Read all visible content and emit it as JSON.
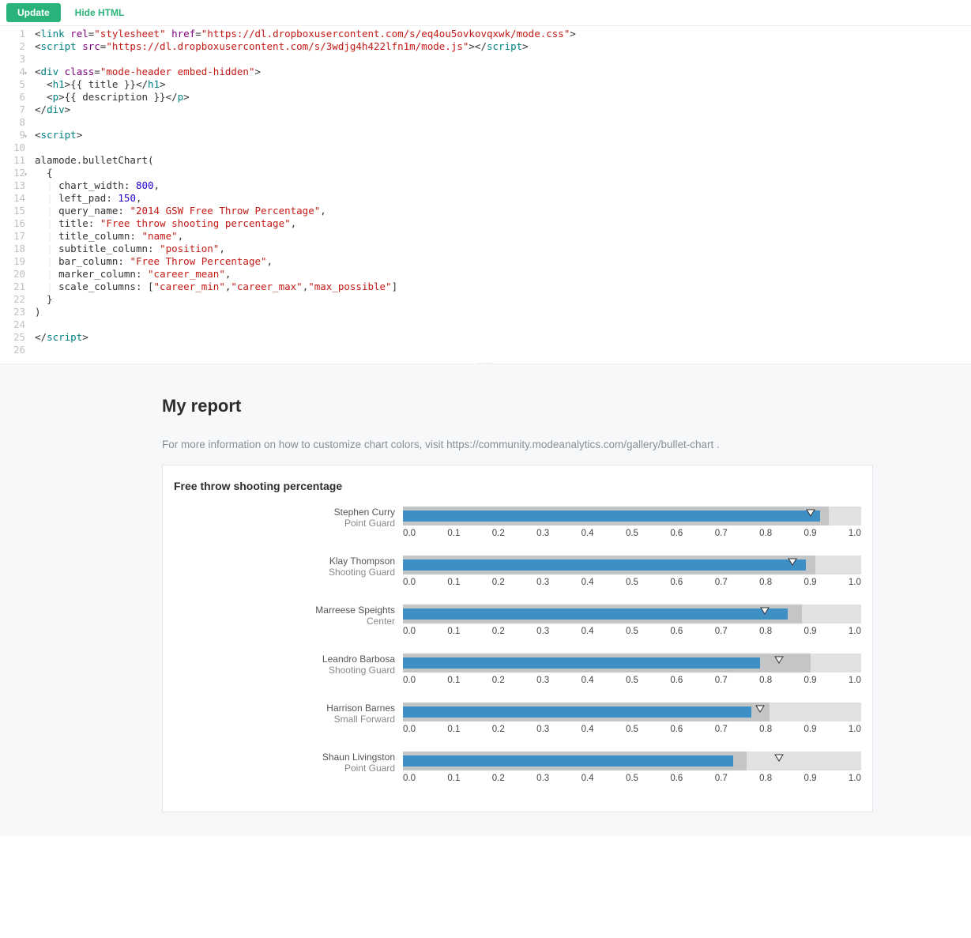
{
  "toolbar": {
    "update_label": "Update",
    "hide_label": "Hide HTML"
  },
  "code_lines": [
    {
      "n": 1,
      "fold": false,
      "html": "&lt;<span class='tag'>link</span> <span class='attr'>rel</span>=<span class='str'>\"stylesheet\"</span> <span class='attr'>href</span>=<span class='str'>\"https://dl.dropboxusercontent.com/s/eq4ou5ovkovqxwk/mode.css\"</span>&gt;"
    },
    {
      "n": 2,
      "fold": false,
      "html": "&lt;<span class='tag'>script</span> <span class='attr'>src</span>=<span class='str'>\"https://dl.dropboxusercontent.com/s/3wdjg4h422lfn1m/mode.js\"</span>&gt;&lt;/<span class='tag'>script</span>&gt;"
    },
    {
      "n": 3,
      "fold": false,
      "html": ""
    },
    {
      "n": 4,
      "fold": true,
      "html": "&lt;<span class='tag'>div</span> <span class='attr'>class</span>=<span class='str'>\"mode-header embed-hidden\"</span>&gt;"
    },
    {
      "n": 5,
      "fold": false,
      "html": "  &lt;<span class='tag'>h1</span>&gt;{{ title }}&lt;/<span class='tag'>h1</span>&gt;"
    },
    {
      "n": 6,
      "fold": false,
      "html": "  &lt;<span class='tag'>p</span>&gt;{{ description }}&lt;/<span class='tag'>p</span>&gt;"
    },
    {
      "n": 7,
      "fold": false,
      "html": "&lt;/<span class='tag'>div</span>&gt;"
    },
    {
      "n": 8,
      "fold": false,
      "html": ""
    },
    {
      "n": 9,
      "fold": true,
      "html": "&lt;<span class='tag'>script</span>&gt;"
    },
    {
      "n": 10,
      "fold": false,
      "html": ""
    },
    {
      "n": 11,
      "fold": false,
      "html": "alamode.bulletChart("
    },
    {
      "n": 12,
      "fold": true,
      "html": "  {"
    },
    {
      "n": 13,
      "fold": false,
      "html": "  <span class='indent'>|</span> chart_width: <span class='num'>800</span>,"
    },
    {
      "n": 14,
      "fold": false,
      "html": "  <span class='indent'>|</span> left_pad: <span class='num'>150</span>,"
    },
    {
      "n": 15,
      "fold": false,
      "html": "  <span class='indent'>|</span> query_name: <span class='str'>\"2014 GSW Free Throw Percentage\"</span>,"
    },
    {
      "n": 16,
      "fold": false,
      "html": "  <span class='indent'>|</span> title: <span class='str'>\"Free throw shooting percentage\"</span>,"
    },
    {
      "n": 17,
      "fold": false,
      "html": "  <span class='indent'>|</span> title_column: <span class='str'>\"name\"</span>,"
    },
    {
      "n": 18,
      "fold": false,
      "html": "  <span class='indent'>|</span> subtitle_column: <span class='str'>\"position\"</span>,"
    },
    {
      "n": 19,
      "fold": false,
      "html": "  <span class='indent'>|</span> bar_column: <span class='str'>\"Free Throw Percentage\"</span>,"
    },
    {
      "n": 20,
      "fold": false,
      "html": "  <span class='indent'>|</span> marker_column: <span class='str'>\"career_mean\"</span>,"
    },
    {
      "n": 21,
      "fold": false,
      "html": "  <span class='indent'>|</span> scale_columns: [<span class='str'>\"career_min\"</span>,<span class='str'>\"career_max\"</span>,<span class='str'>\"max_possible\"</span>]"
    },
    {
      "n": 22,
      "fold": false,
      "html": "  }"
    },
    {
      "n": 23,
      "fold": false,
      "html": ")"
    },
    {
      "n": 24,
      "fold": false,
      "html": ""
    },
    {
      "n": 25,
      "fold": false,
      "html": "&lt;/<span class='tag'>script</span>&gt;"
    },
    {
      "n": 26,
      "fold": false,
      "html": ""
    }
  ],
  "report": {
    "title": "My report",
    "description": "For more information on how to customize chart colors, visit https://community.modeanalytics.com/gallery/bullet-chart ."
  },
  "chart_data": {
    "type": "bar",
    "subtype": "bullet",
    "title": "Free throw shooting percentage",
    "xlim": [
      0.0,
      1.0
    ],
    "ticks": [
      "0.0",
      "0.1",
      "0.2",
      "0.3",
      "0.4",
      "0.5",
      "0.6",
      "0.7",
      "0.8",
      "0.9",
      "1.0"
    ],
    "series": [
      {
        "name": "Stephen Curry",
        "subtitle": "Point Guard",
        "bar": 0.91,
        "career_mean": 0.89,
        "range_mid": 0.93,
        "range_max": 1.0
      },
      {
        "name": "Klay Thompson",
        "subtitle": "Shooting Guard",
        "bar": 0.88,
        "career_mean": 0.85,
        "range_mid": 0.9,
        "range_max": 1.0
      },
      {
        "name": "Marreese Speights",
        "subtitle": "Center",
        "bar": 0.84,
        "career_mean": 0.79,
        "range_mid": 0.87,
        "range_max": 1.0
      },
      {
        "name": "Leandro Barbosa",
        "subtitle": "Shooting Guard",
        "bar": 0.78,
        "career_mean": 0.82,
        "range_mid": 0.89,
        "range_max": 1.0
      },
      {
        "name": "Harrison Barnes",
        "subtitle": "Small Forward",
        "bar": 0.76,
        "career_mean": 0.78,
        "range_mid": 0.8,
        "range_max": 1.0
      },
      {
        "name": "Shaun Livingston",
        "subtitle": "Point Guard",
        "bar": 0.72,
        "career_mean": 0.82,
        "range_mid": 0.75,
        "range_max": 1.0
      }
    ]
  }
}
